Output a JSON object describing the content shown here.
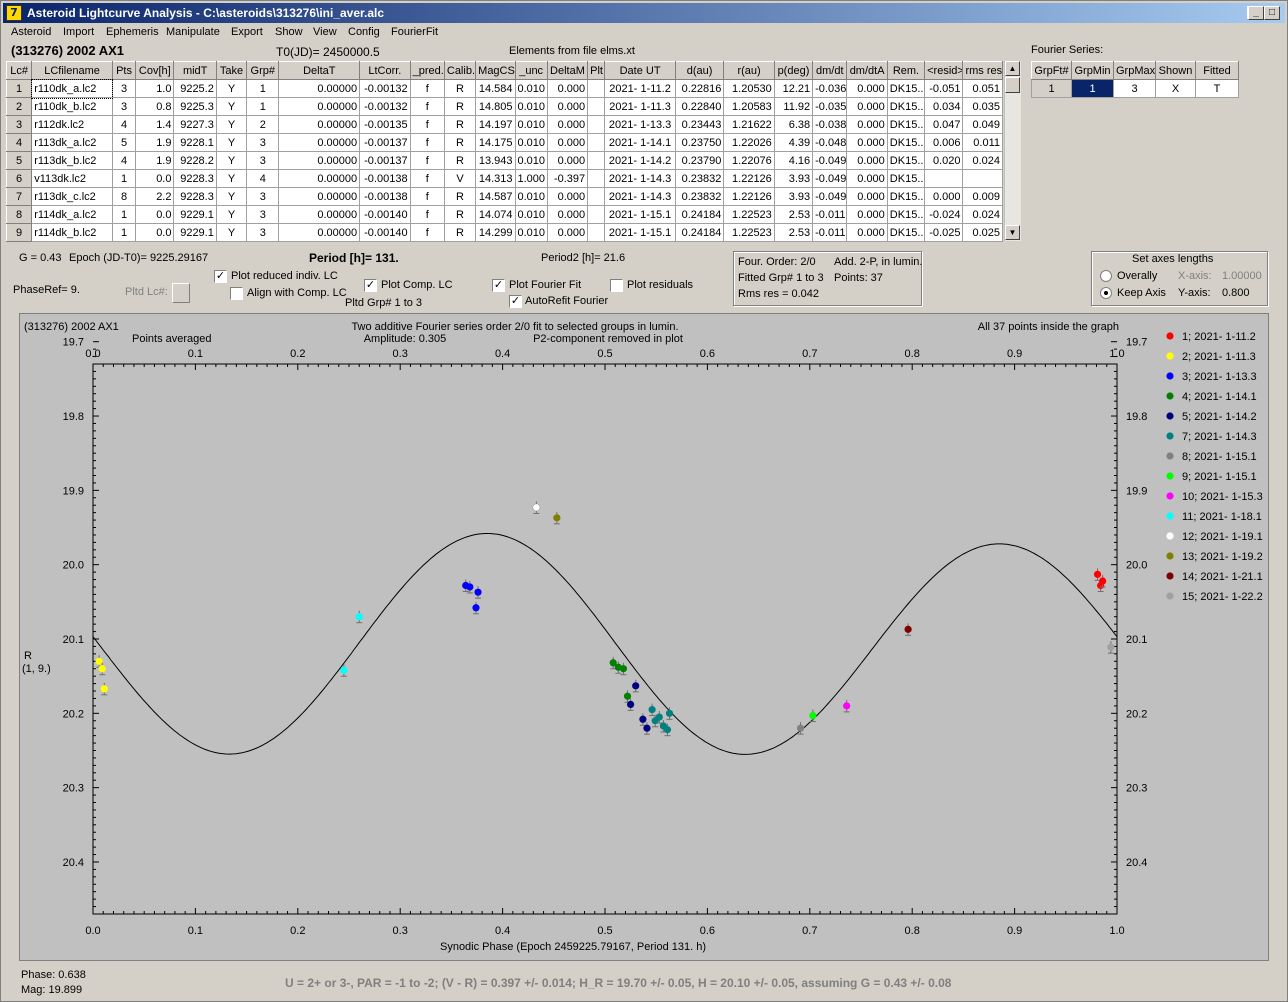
{
  "window": {
    "title": "Asteroid Lightcurve Analysis - C:\\asteroids\\313276\\ini_aver.alc"
  },
  "menu": [
    "Asteroid",
    "Import",
    "Ephemeris",
    "Manipulate",
    "Export",
    "Show",
    "View",
    "Config",
    "FourierFit"
  ],
  "header": {
    "asteroid": "(313276) 2002 AX1",
    "t0": "T0(JD)= 2450000.5",
    "elements": "Elements from file elms.xt",
    "fourier_label": "Fourier Series:"
  },
  "lc_table": {
    "columns": [
      "Lc#",
      "LCfilename",
      "Pts",
      "Cov[h]",
      "midT",
      "Take",
      "Grp#",
      "DeltaT",
      "LtCorr.",
      "_pred.",
      "Calib.",
      "MagCS",
      "_unc",
      "DeltaM",
      "Plt",
      "Date UT",
      "d(au)",
      "r(au)",
      "p(deg)",
      "dm/dt",
      "dm/dtA",
      "Rem.",
      "<resid>",
      "rms res"
    ],
    "rows": [
      [
        "1",
        "r110dk_a.lc2",
        "3",
        "1.0",
        "9225.2",
        "Y",
        "1",
        "0.00000",
        "-0.00132",
        "f",
        "R",
        "14.584",
        "0.010",
        "0.000",
        "",
        "2021- 1-11.2",
        "0.22816",
        "1.20530",
        "12.21",
        "-0.036",
        "0.000",
        "DK15..",
        "-0.051",
        "0.051"
      ],
      [
        "2",
        "r110dk_b.lc2",
        "3",
        "0.8",
        "9225.3",
        "Y",
        "1",
        "0.00000",
        "-0.00132",
        "f",
        "R",
        "14.805",
        "0.010",
        "0.000",
        "",
        "2021- 1-11.3",
        "0.22840",
        "1.20583",
        "11.92",
        "-0.035",
        "0.000",
        "DK15..",
        "0.034",
        "0.035"
      ],
      [
        "3",
        "r112dk.lc2",
        "4",
        "1.4",
        "9227.3",
        "Y",
        "2",
        "0.00000",
        "-0.00135",
        "f",
        "R",
        "14.197",
        "0.010",
        "0.000",
        "",
        "2021- 1-13.3",
        "0.23443",
        "1.21622",
        "6.38",
        "-0.038",
        "0.000",
        "DK15..",
        "0.047",
        "0.049"
      ],
      [
        "4",
        "r113dk_a.lc2",
        "5",
        "1.9",
        "9228.1",
        "Y",
        "3",
        "0.00000",
        "-0.00137",
        "f",
        "R",
        "14.175",
        "0.010",
        "0.000",
        "",
        "2021- 1-14.1",
        "0.23750",
        "1.22026",
        "4.39",
        "-0.048",
        "0.000",
        "DK15..",
        "0.006",
        "0.011"
      ],
      [
        "5",
        "r113dk_b.lc2",
        "4",
        "1.9",
        "9228.2",
        "Y",
        "3",
        "0.00000",
        "-0.00137",
        "f",
        "R",
        "13.943",
        "0.010",
        "0.000",
        "",
        "2021- 1-14.2",
        "0.23790",
        "1.22076",
        "4.16",
        "-0.049",
        "0.000",
        "DK15..",
        "0.020",
        "0.024"
      ],
      [
        "6",
        "v113dk.lc2",
        "1",
        "0.0",
        "9228.3",
        "Y",
        "4",
        "0.00000",
        "-0.00138",
        "f",
        "V",
        "14.313",
        "1.000",
        "-0.397",
        "",
        "2021- 1-14.3",
        "0.23832",
        "1.22126",
        "3.93",
        "-0.049",
        "0.000",
        "DK15..",
        "",
        ""
      ],
      [
        "7",
        "r113dk_c.lc2",
        "8",
        "2.2",
        "9228.3",
        "Y",
        "3",
        "0.00000",
        "-0.00138",
        "f",
        "R",
        "14.587",
        "0.010",
        "0.000",
        "",
        "2021- 1-14.3",
        "0.23832",
        "1.22126",
        "3.93",
        "-0.049",
        "0.000",
        "DK15..",
        "0.000",
        "0.009"
      ],
      [
        "8",
        "r114dk_a.lc2",
        "1",
        "0.0",
        "9229.1",
        "Y",
        "3",
        "0.00000",
        "-0.00140",
        "f",
        "R",
        "14.074",
        "0.010",
        "0.000",
        "",
        "2021- 1-15.1",
        "0.24184",
        "1.22523",
        "2.53",
        "-0.011",
        "0.000",
        "DK15..",
        "-0.024",
        "0.024"
      ],
      [
        "9",
        "r114dk_b.lc2",
        "1",
        "0.0",
        "9229.1",
        "Y",
        "3",
        "0.00000",
        "-0.00140",
        "f",
        "R",
        "14.299",
        "0.010",
        "0.000",
        "",
        "2021- 1-15.1",
        "0.24184",
        "1.22523",
        "2.53",
        "-0.011",
        "0.000",
        "DK15..",
        "-0.025",
        "0.025"
      ]
    ]
  },
  "fourier_table": {
    "columns": [
      "GrpFt#",
      "GrpMin",
      "GrpMax",
      "Shown",
      "Fitted"
    ],
    "row": [
      "1",
      "1",
      "3",
      "X",
      "T"
    ]
  },
  "controls": {
    "g": "G = 0.43",
    "epoch": "Epoch (JD-T0)= 9225.29167",
    "period": "Period [h]= 131.",
    "period2": "Period2 [h]= 21.6",
    "phaseref": "PhaseRef= 9.",
    "pltd_lc": "Pltd Lc#:",
    "plot_reduced": "Plot reduced indiv. LC",
    "align_comp": "Align with Comp. LC",
    "plot_comp": "Plot Comp. LC",
    "pltd_grp": "Pltd Grp#  1   to   3",
    "plot_fourier": "Plot Fourier Fit",
    "autorefit": "AutoRefit Fourier",
    "plot_residuals": "Plot residuals"
  },
  "fourier_info": {
    "line1a": "Four. Order:  2/0",
    "line1b": "Add. 2-P, in lumin.",
    "line2a": "Fitted Grp# 1 to 3",
    "line2b": "Points: 37",
    "line3": "Rms res     = 0.042"
  },
  "axes_box": {
    "title": "Set axes lengths",
    "overally": "Overally",
    "keep_axis": "Keep Axis",
    "xaxis_label": "X-axis:",
    "xaxis_value": "1.00000",
    "yaxis_label": "Y-axis:",
    "yaxis_value": "0.800"
  },
  "plot_text": {
    "name": "(313276) 2002 AX1",
    "averaged": "Points averaged",
    "desc1": "Two additive Fourier series order 2/0 fit to selected groups in lumin.",
    "desc2": "Amplitude: 0.305",
    "desc3": "P2-component removed in plot",
    "inside": "All 37 points inside the graph",
    "ylabel1": "R",
    "ylabel2": "(1, 9.)",
    "xlabel": "Synodic Phase (Epoch 2459225.79167, Period 131. h)"
  },
  "status": {
    "phase": "Phase:  0.638",
    "mag": "Mag:   19.899",
    "summary": "U = 2+ or 3-, PAR = -1 to -2; (V - R) = 0.397 +/- 0.014; H_R = 19.70 +/- 0.05, H = 20.10 +/- 0.05, assuming G = 0.43 +/- 0.08"
  },
  "chart_data": {
    "type": "scatter",
    "xlabel": "Synodic Phase (Epoch 2459225.79167, Period 131. h)",
    "ylabel": "R",
    "xlim": [
      0.0,
      1.0
    ],
    "ylim": [
      20.47,
      19.73
    ],
    "xticks": [
      "0.0",
      "0.1",
      "0.2",
      "0.3",
      "0.4",
      "0.5",
      "0.6",
      "0.7",
      "0.8",
      "0.9",
      "1.0"
    ],
    "yticks": [
      "19.7",
      "19.8",
      "19.9",
      "20.0",
      "20.1",
      "20.2",
      "20.3",
      "20.4"
    ],
    "fourier_fit": {
      "mean": 20.11,
      "amplitude": 0.305,
      "shape": "two-peak"
    },
    "legend_position": "right",
    "series": [
      {
        "name": "1; 2021- 1-11.2",
        "color": "#ff0000",
        "points": [
          [
            0.981,
            20.013
          ],
          [
            0.984,
            20.028
          ],
          [
            0.986,
            20.022
          ]
        ]
      },
      {
        "name": "2; 2021- 1-11.3",
        "color": "#ffff00",
        "points": [
          [
            0.006,
            20.13
          ],
          [
            0.009,
            20.14
          ],
          [
            0.011,
            20.167
          ]
        ]
      },
      {
        "name": "3; 2021- 1-13.3",
        "color": "#0000ff",
        "points": [
          [
            0.364,
            20.028
          ],
          [
            0.368,
            20.03
          ],
          [
            0.374,
            20.058
          ],
          [
            0.376,
            20.037
          ]
        ]
      },
      {
        "name": "4; 2021- 1-14.1",
        "color": "#008000",
        "points": [
          [
            0.508,
            20.132
          ],
          [
            0.513,
            20.138
          ],
          [
            0.518,
            20.14
          ],
          [
            0.522,
            20.177
          ]
        ]
      },
      {
        "name": "5; 2021- 1-14.2",
        "color": "#000080",
        "points": [
          [
            0.525,
            20.188
          ],
          [
            0.53,
            20.163
          ],
          [
            0.537,
            20.208
          ],
          [
            0.541,
            20.22
          ]
        ]
      },
      {
        "name": "7; 2021- 1-14.3",
        "color": "#008080",
        "points": [
          [
            0.546,
            20.195
          ],
          [
            0.549,
            20.21
          ],
          [
            0.553,
            20.205
          ],
          [
            0.557,
            20.217
          ],
          [
            0.561,
            20.222
          ],
          [
            0.563,
            20.2
          ]
        ]
      },
      {
        "name": "8; 2021- 1-15.1",
        "color": "#808080",
        "points": [
          [
            0.691,
            20.22
          ]
        ]
      },
      {
        "name": "9; 2021- 1-15.1",
        "color": "#00ff00",
        "points": [
          [
            0.703,
            20.203
          ]
        ]
      },
      {
        "name": "10; 2021- 1-15.3",
        "color": "#ff00ff",
        "points": [
          [
            0.736,
            20.19
          ]
        ]
      },
      {
        "name": "11; 2021- 1-18.1",
        "color": "#00ffff",
        "points": [
          [
            0.245,
            20.142
          ],
          [
            0.26,
            20.07
          ]
        ]
      },
      {
        "name": "12; 2021- 1-19.1",
        "color": "#ffffff",
        "points": [
          [
            0.433,
            19.923
          ]
        ]
      },
      {
        "name": "13; 2021- 1-19.2",
        "color": "#808000",
        "points": [
          [
            0.453,
            19.937
          ]
        ]
      },
      {
        "name": "14; 2021- 1-21.1",
        "color": "#800000",
        "points": [
          [
            0.796,
            20.087
          ]
        ]
      },
      {
        "name": "15; 2021- 1-22.2",
        "color": "#a0a0a0",
        "points": [
          [
            0.994,
            20.111
          ]
        ]
      }
    ]
  }
}
